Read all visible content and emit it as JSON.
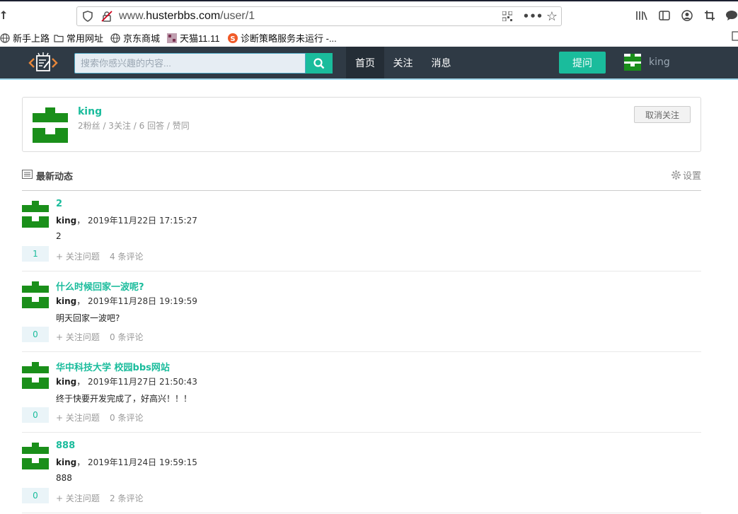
{
  "browser": {
    "url_prefix": "www.",
    "url_domain": "husterbbs.com",
    "url_path": "/user/1",
    "bookmarks": [
      {
        "label": "新手上路",
        "icon": "globe-icon"
      },
      {
        "label": "常用网址",
        "icon": "folder-icon"
      },
      {
        "label": "京东商城",
        "icon": "globe-icon"
      },
      {
        "label": "天猫11.11",
        "icon": "tmall-icon"
      },
      {
        "label": "诊断策略服务未运行 -...",
        "icon": "sogou-icon"
      }
    ]
  },
  "nav": {
    "search_placeholder": "搜索你感兴趣的内容...",
    "items": [
      "首页",
      "关注",
      "消息"
    ],
    "ask_label": "提问",
    "username": "king"
  },
  "profile": {
    "name": "king",
    "stats": "2粉丝 / 3关注 / 6 回答 / 赞同",
    "unfollow_label": "取消关注"
  },
  "feed": {
    "title": "最新动态",
    "settings_label": "设置",
    "follow_label": "+ 关注问题",
    "items": [
      {
        "title": "2",
        "user": "king",
        "time": "， 2019年11月22日 17:15:27",
        "content": "2",
        "votes": "1",
        "comments": "4 条评论"
      },
      {
        "title": "什么时候回家一波呢?",
        "user": "king",
        "time": "， 2019年11月28日 19:19:59",
        "content": "明天回家一波吧?",
        "votes": "0",
        "comments": "0 条评论"
      },
      {
        "title": "华中科技大学 校园bbs网站",
        "user": "king",
        "time": "， 2019年11月27日 21:50:43",
        "content": "终于快要开发完成了，好高兴！！！",
        "votes": "0",
        "comments": "0 条评论"
      },
      {
        "title": "888",
        "user": "king",
        "time": "， 2019年11月24日 19:59:15",
        "content": "888",
        "votes": "0",
        "comments": "2 条评论"
      }
    ]
  },
  "colors": {
    "accent": "#1abc9c",
    "nav_bg": "#2f3a45",
    "avatar_green": "#1a8f1a"
  }
}
